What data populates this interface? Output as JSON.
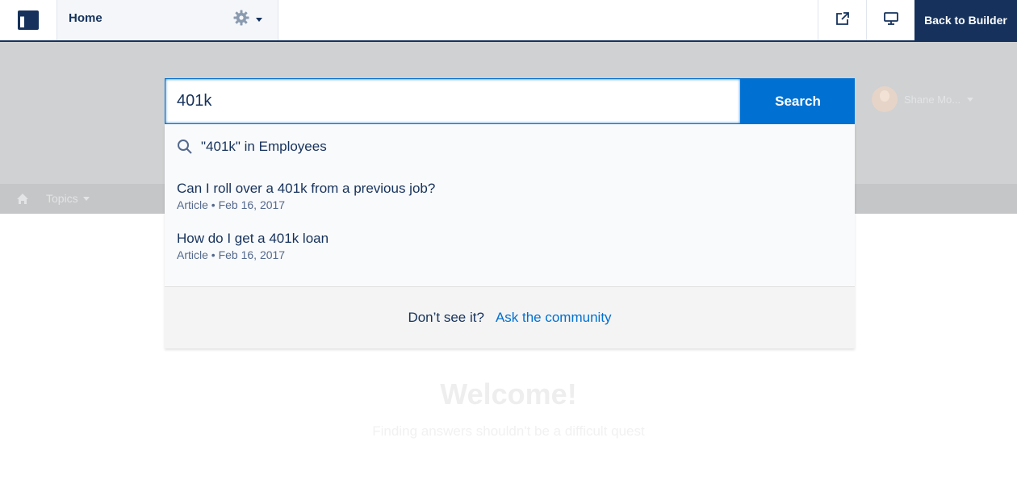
{
  "builder": {
    "page_name": "Home",
    "back_label": "Back to Builder"
  },
  "community": {
    "nav_topics": "Topics",
    "user_name": "Shane Mo...",
    "welcome_title": "Welcome!",
    "welcome_subtitle": "Finding answers shouldn't be a difficult quest"
  },
  "search": {
    "query": "401k",
    "button_label": "Search",
    "scope_suggestion": "\"401k\" in Employees",
    "results": [
      {
        "title": "Can I roll over a 401k from a previous job?",
        "meta": "Article • Feb 16, 2017"
      },
      {
        "title": "How do I get a 401k loan",
        "meta": "Article • Feb 16, 2017"
      }
    ],
    "footer_prompt": "Don’t see it?",
    "footer_link": "Ask the community"
  },
  "colors": {
    "navy": "#16325c",
    "brand_blue": "#0070d2",
    "overlay_gray": "#cfd1d2"
  },
  "icons": [
    "layout-icon",
    "gear-icon",
    "external-link-icon",
    "desktop-preview-icon",
    "home-icon",
    "search-icon"
  ]
}
